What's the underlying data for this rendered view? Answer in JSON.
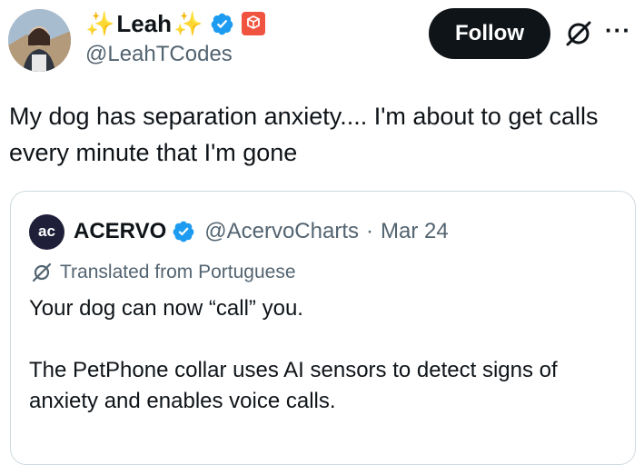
{
  "author": {
    "sparkle_left": "✨",
    "display_name": "Leah",
    "sparkle_right": "✨",
    "handle": "@LeahTCodes",
    "avatar_icon": "profile-photo",
    "affiliation_icon": "laravel-logo"
  },
  "actions": {
    "follow_label": "Follow",
    "more_label": "···"
  },
  "post": {
    "text": "My dog has separation anxiety.... I'm about to get calls every minute that I'm gone"
  },
  "quoted": {
    "avatar_text": "ac",
    "display_name": "ACERVO",
    "handle": "@AcervoCharts",
    "separator": "·",
    "date": "Mar 24",
    "translated_label": "Translated from Portuguese",
    "paragraph_1": "Your dog can now “call” you.",
    "paragraph_2": "The PetPhone collar uses AI sensors to detect signs of anxiety and enables voice calls."
  },
  "colors": {
    "text": "#0f1419",
    "secondary": "#536471",
    "verified": "#1d9bf0",
    "follow_bg": "#0f1419",
    "border": "#cfd9de"
  }
}
